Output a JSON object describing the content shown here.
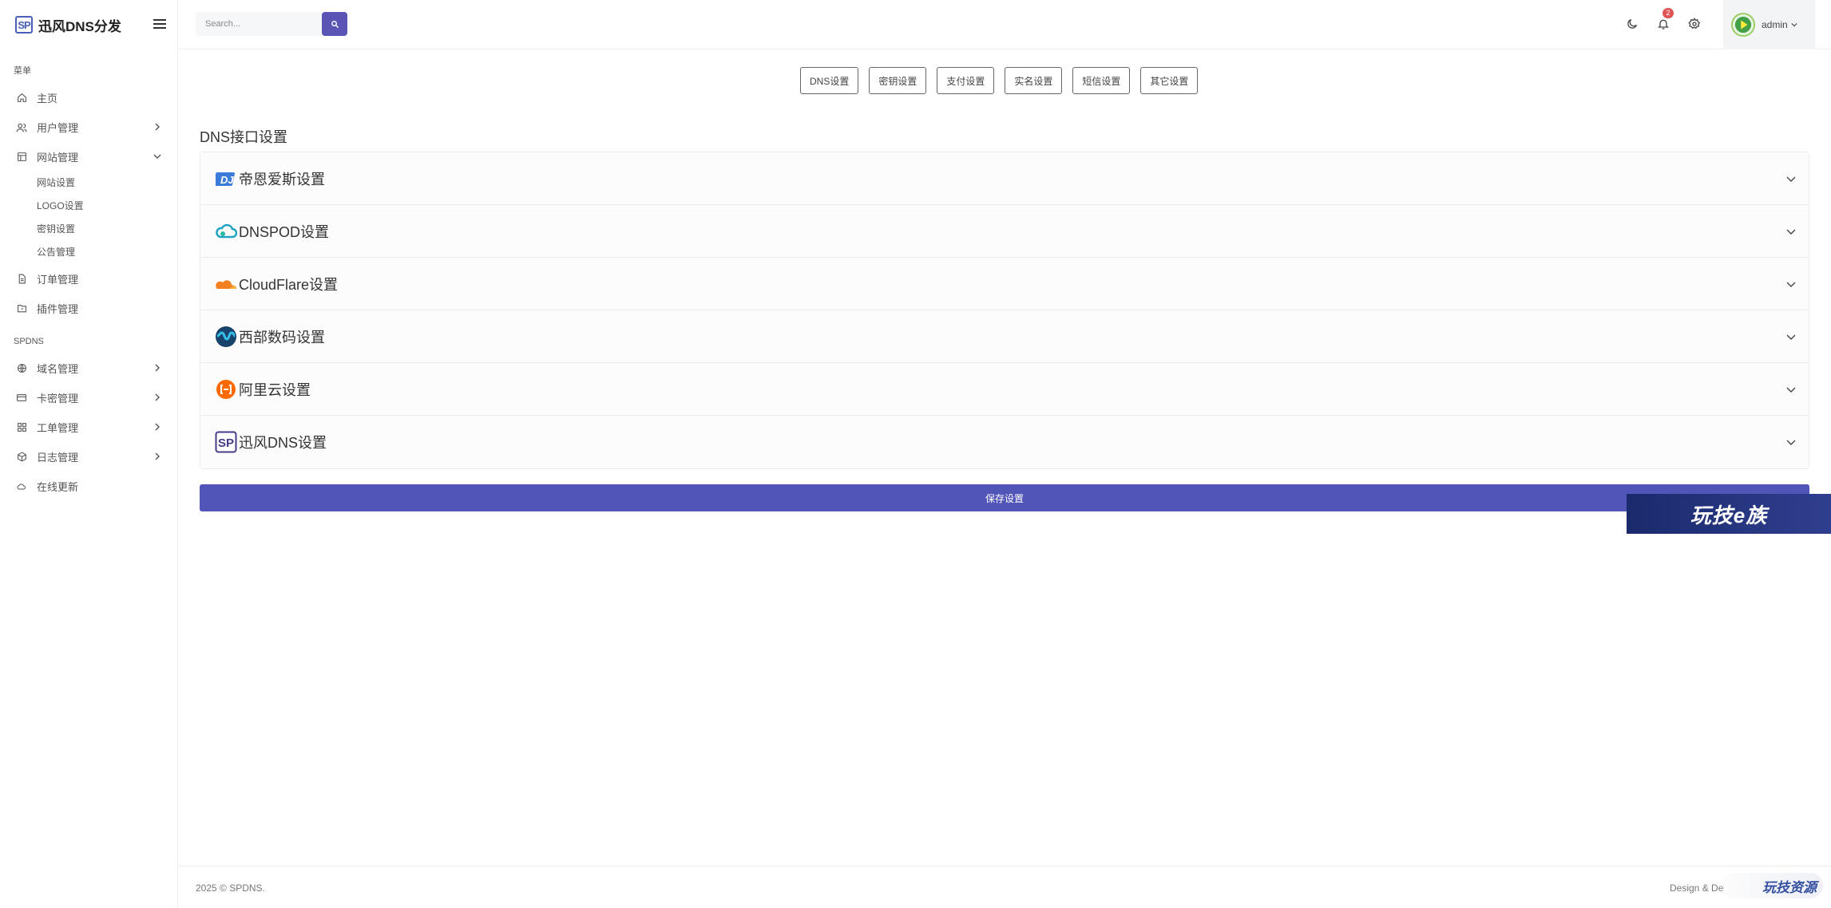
{
  "brand": {
    "logo_text": "SP",
    "name": "迅风DNS分发"
  },
  "sidebar": {
    "menu_title": "菜单",
    "items": [
      {
        "label": "主页",
        "icon": "home-icon",
        "has_chevron": false
      },
      {
        "label": "用户管理",
        "icon": "users-icon",
        "has_chevron": true
      },
      {
        "label": "网站管理",
        "icon": "layout-icon",
        "has_chevron": true,
        "expanded": true
      }
    ],
    "sub_items": [
      "网站设置",
      "LOGO设置",
      "密钥设置",
      "公告管理"
    ],
    "items2": [
      {
        "label": "订单管理",
        "icon": "file-icon"
      },
      {
        "label": "插件管理",
        "icon": "folder-icon"
      }
    ],
    "section2_title": "SPDNS",
    "items3": [
      {
        "label": "域名管理",
        "icon": "globe-icon",
        "has_chevron": true
      },
      {
        "label": "卡密管理",
        "icon": "card-icon",
        "has_chevron": true
      },
      {
        "label": "工单管理",
        "icon": "grid-icon",
        "has_chevron": true
      },
      {
        "label": "日志管理",
        "icon": "box-icon",
        "has_chevron": true
      },
      {
        "label": "在线更新",
        "icon": "cloud-icon",
        "has_chevron": false
      }
    ]
  },
  "topbar": {
    "search_placeholder": "Search...",
    "notification_count": "2",
    "user_name": "admin"
  },
  "tabs": [
    "DNS设置",
    "密钥设置",
    "支付设置",
    "实名设置",
    "短信设置",
    "其它设置"
  ],
  "section_title": "DNS接口设置",
  "providers": [
    {
      "label": "帝恩爱斯设置",
      "icon": "dns-logo-icon"
    },
    {
      "label": "DNSPOD设置",
      "icon": "dnspod-logo-icon"
    },
    {
      "label": "CloudFlare设置",
      "icon": "cloudflare-logo-icon"
    },
    {
      "label": "西部数码设置",
      "icon": "westcn-logo-icon"
    },
    {
      "label": "阿里云设置",
      "icon": "aliyun-logo-icon"
    },
    {
      "label": "迅风DNS设置",
      "icon": "spdns-logo-icon"
    }
  ],
  "save_label": "保存设置",
  "watermark": "玩技e族",
  "footer": {
    "copyright": "2025 © SPDNS.",
    "right_text": "Design & De",
    "badge_text": "玩技资源"
  },
  "colors": {
    "accent": "#5155b8",
    "badge": "#e05555"
  }
}
